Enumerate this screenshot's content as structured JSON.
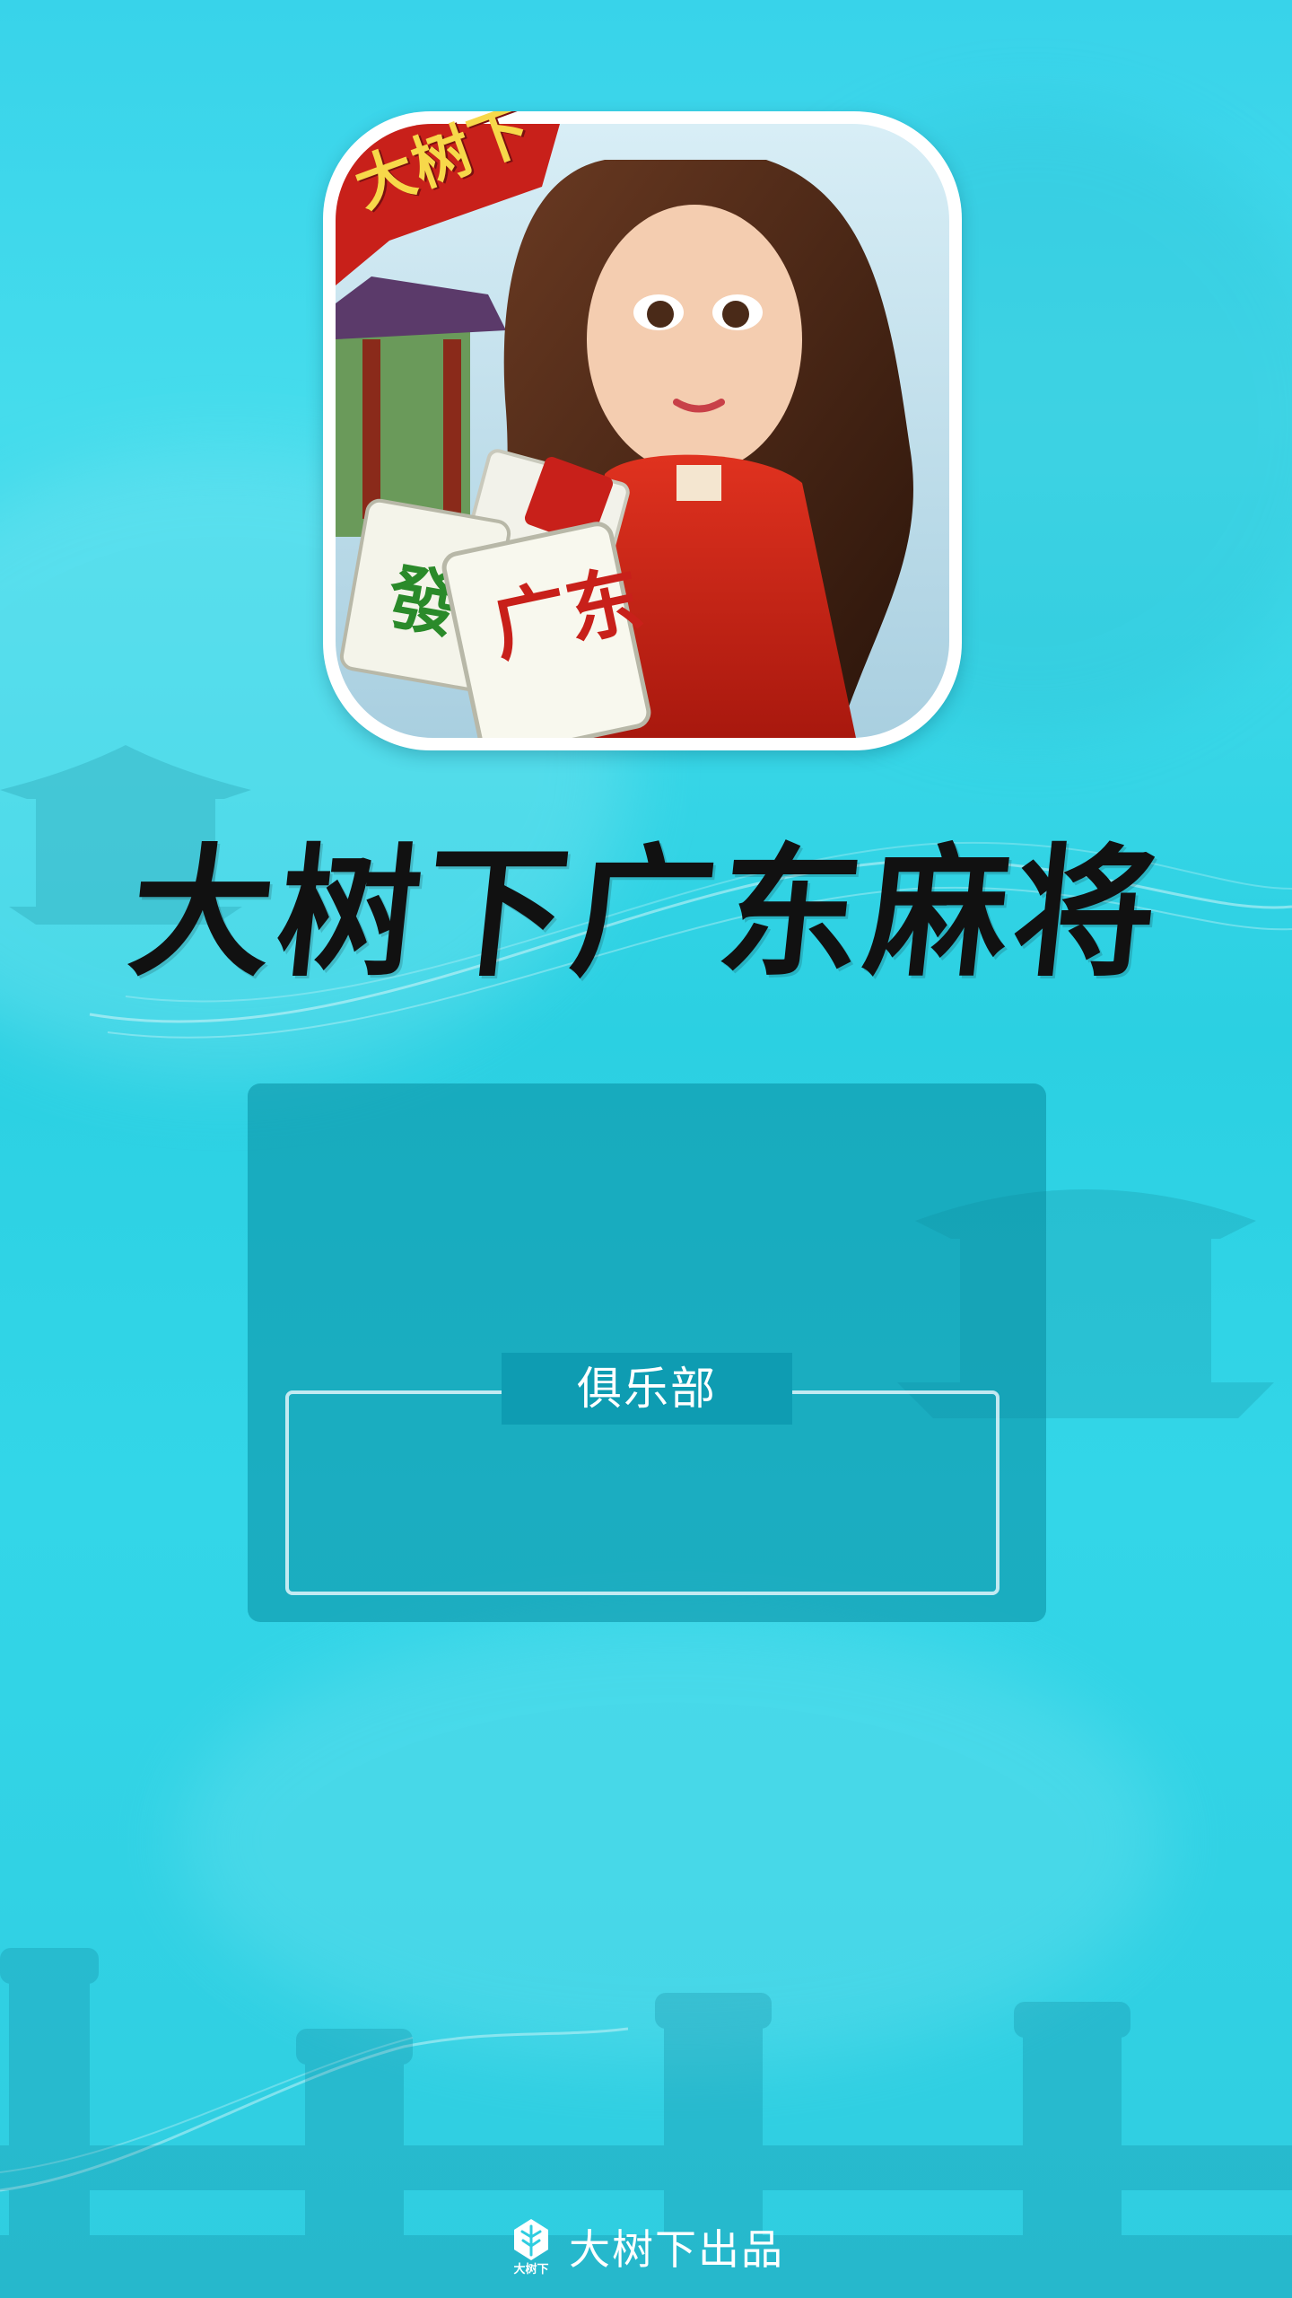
{
  "app_icon": {
    "banner_text": "大树下",
    "tile_text": "广东",
    "tile_green_text": "發"
  },
  "app_title": "大树下广东麻将",
  "club_section": {
    "label": "俱乐部"
  },
  "footer": {
    "logo_text": "大树下",
    "text": "大树下出品"
  }
}
